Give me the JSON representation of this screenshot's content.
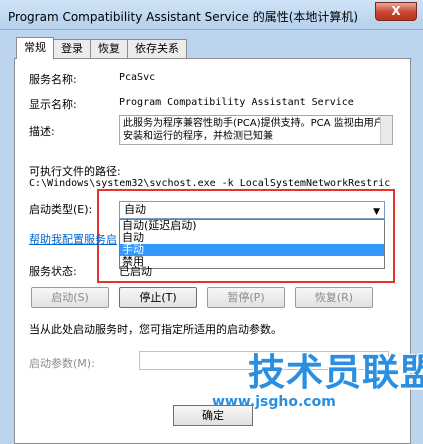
{
  "window": {
    "title": "Program Compatibility Assistant Service 的属性(本地计算机)",
    "close_label": "X"
  },
  "tabs": [
    {
      "label": "常规",
      "active": true
    },
    {
      "label": "登录",
      "active": false
    },
    {
      "label": "恢复",
      "active": false
    },
    {
      "label": "依存关系",
      "active": false
    }
  ],
  "general": {
    "service_name_label": "服务名称:",
    "service_name": "PcaSvc",
    "display_name_label": "显示名称:",
    "display_name": "Program Compatibility Assistant Service",
    "description_label": "描述:",
    "description": "此服务为程序兼容性助手(PCA)提供支持。PCA 监视由用户安装和运行的程序，并检测已知兼",
    "path_label": "可执行文件的路径:",
    "path": "C:\\Windows\\system32\\svchost.exe -k LocalSystemNetworkRestric",
    "startup_type_label": "启动类型(E):",
    "startup_type_value": "自动",
    "startup_options": [
      {
        "label": "自动(延迟启动)",
        "selected": false
      },
      {
        "label": "自动",
        "selected": false
      },
      {
        "label": "手动",
        "selected": true
      },
      {
        "label": "禁用",
        "selected": false
      }
    ],
    "help_link": "帮助我配置服务启",
    "status_label": "服务状态:",
    "status_value": "已启动",
    "buttons": {
      "start": "启动(S)",
      "stop": "停止(T)",
      "pause": "暂停(P)",
      "resume": "恢复(R)"
    },
    "hint": "当从此处启动服务时，您可指定所适用的启动参数。",
    "params_label": "启动参数(M):",
    "params_value": ""
  },
  "footer": {
    "ok_label": "确定"
  },
  "watermark": {
    "brand": "技术员联盟",
    "url": "www.jsgho.com"
  }
}
